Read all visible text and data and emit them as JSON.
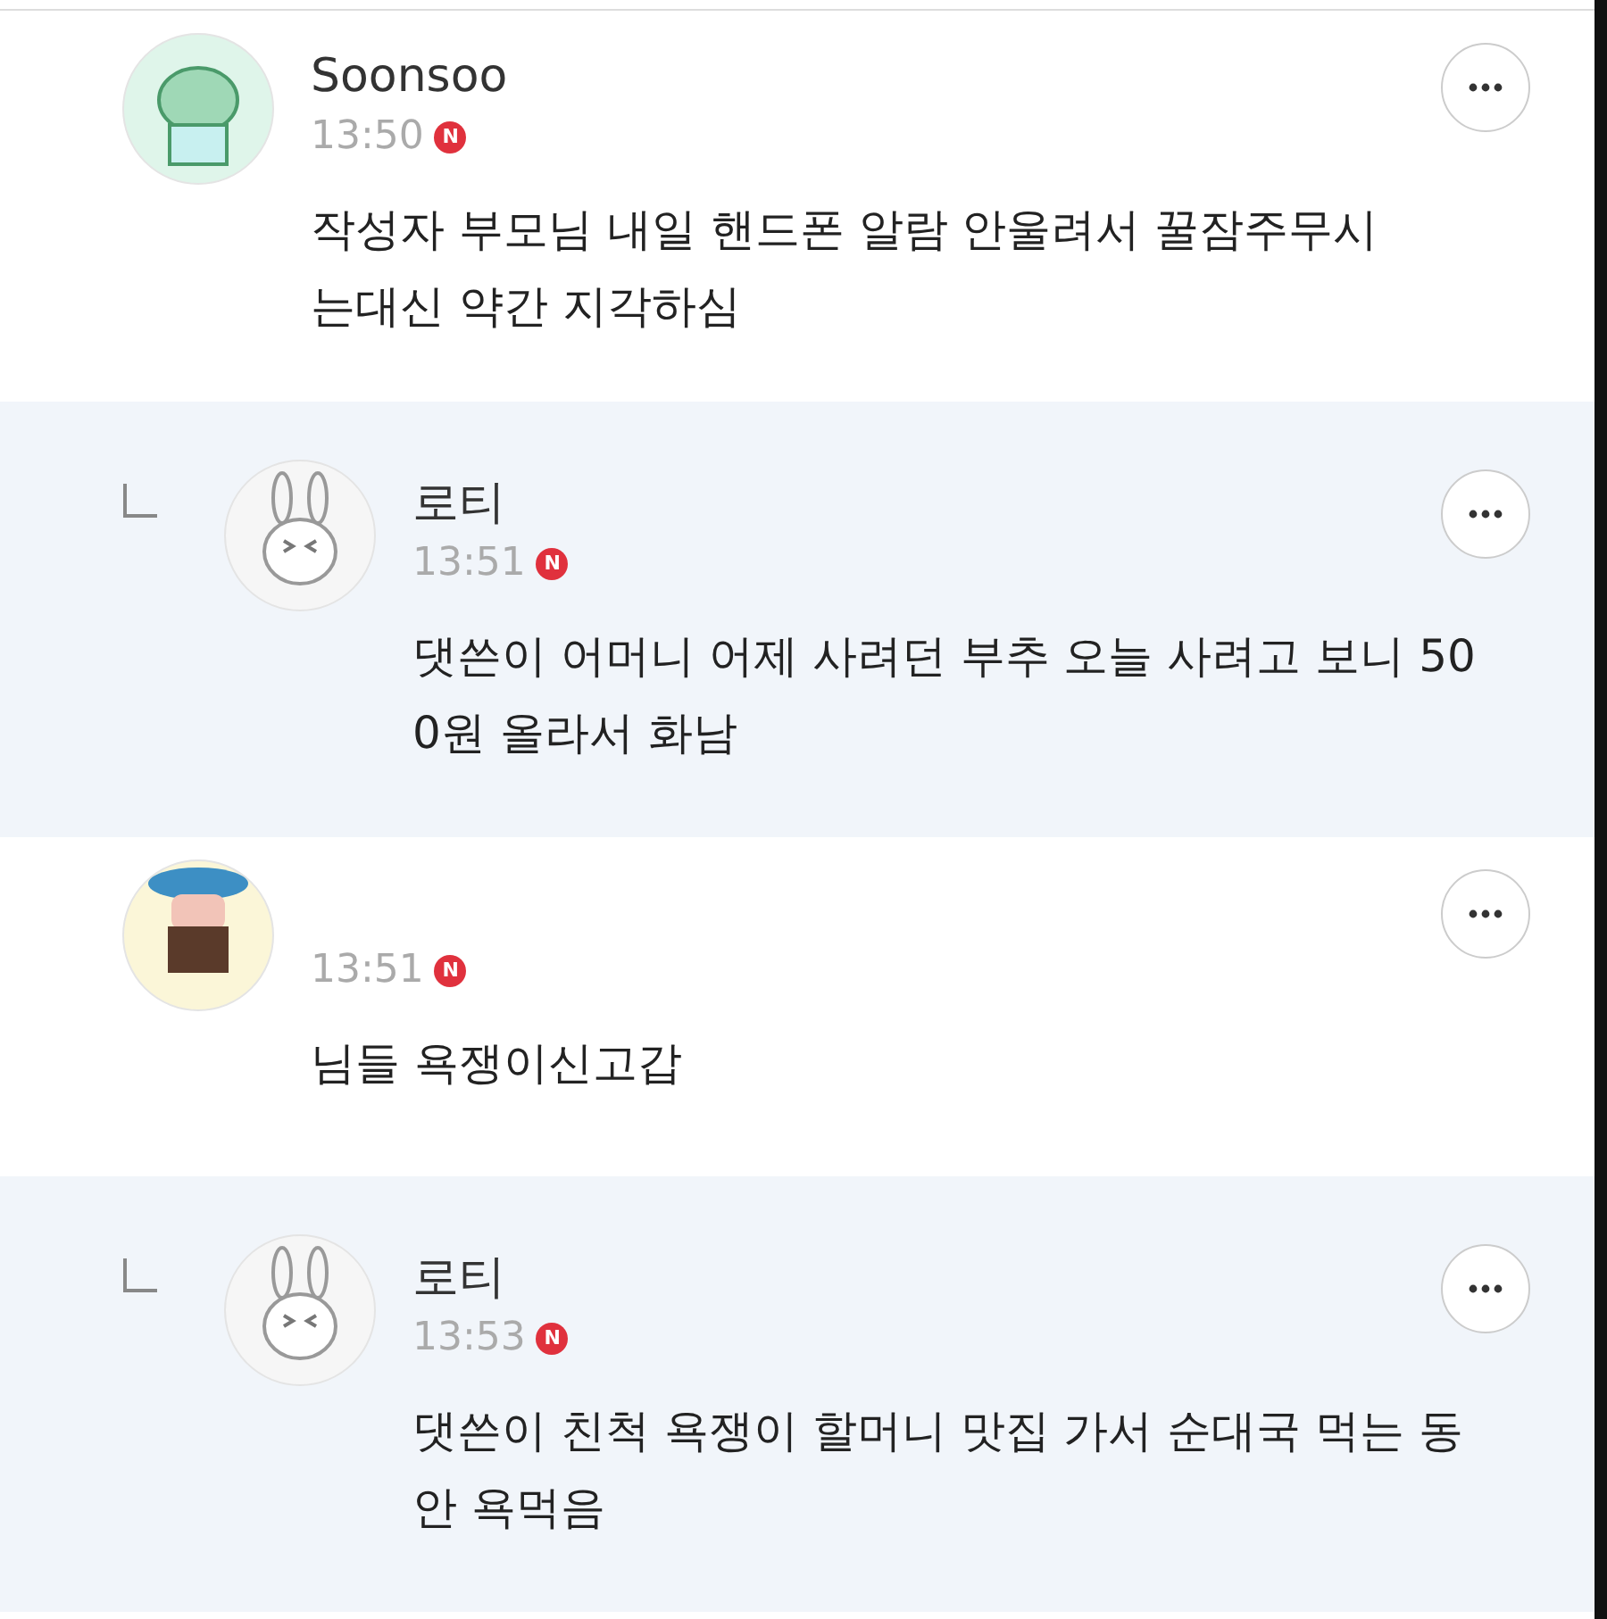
{
  "comments": [
    {
      "kind": "comment",
      "name": "Soonsoo",
      "time": "13:50",
      "badge": "N",
      "text": "작성자 부모님 내일 핸드폰 알람 안울려서 꿀잠주무시는대신 약간 지각하심"
    },
    {
      "kind": "reply",
      "name": "로티",
      "time": "13:51",
      "badge": "N",
      "text": "댓쓴이 어머니 어제 사려던 부추 오늘 사려고 보니 500원 올라서 화남"
    },
    {
      "kind": "comment",
      "time": "13:51",
      "badge": "N",
      "text": "님들 욕쟁이신고갑"
    },
    {
      "kind": "reply",
      "name": "로티",
      "time": "13:53",
      "badge": "N",
      "text": "댓쓴이 친척 욕쟁이 할머니 맛집 가서 순대국 먹는 동안 욕먹음"
    }
  ]
}
